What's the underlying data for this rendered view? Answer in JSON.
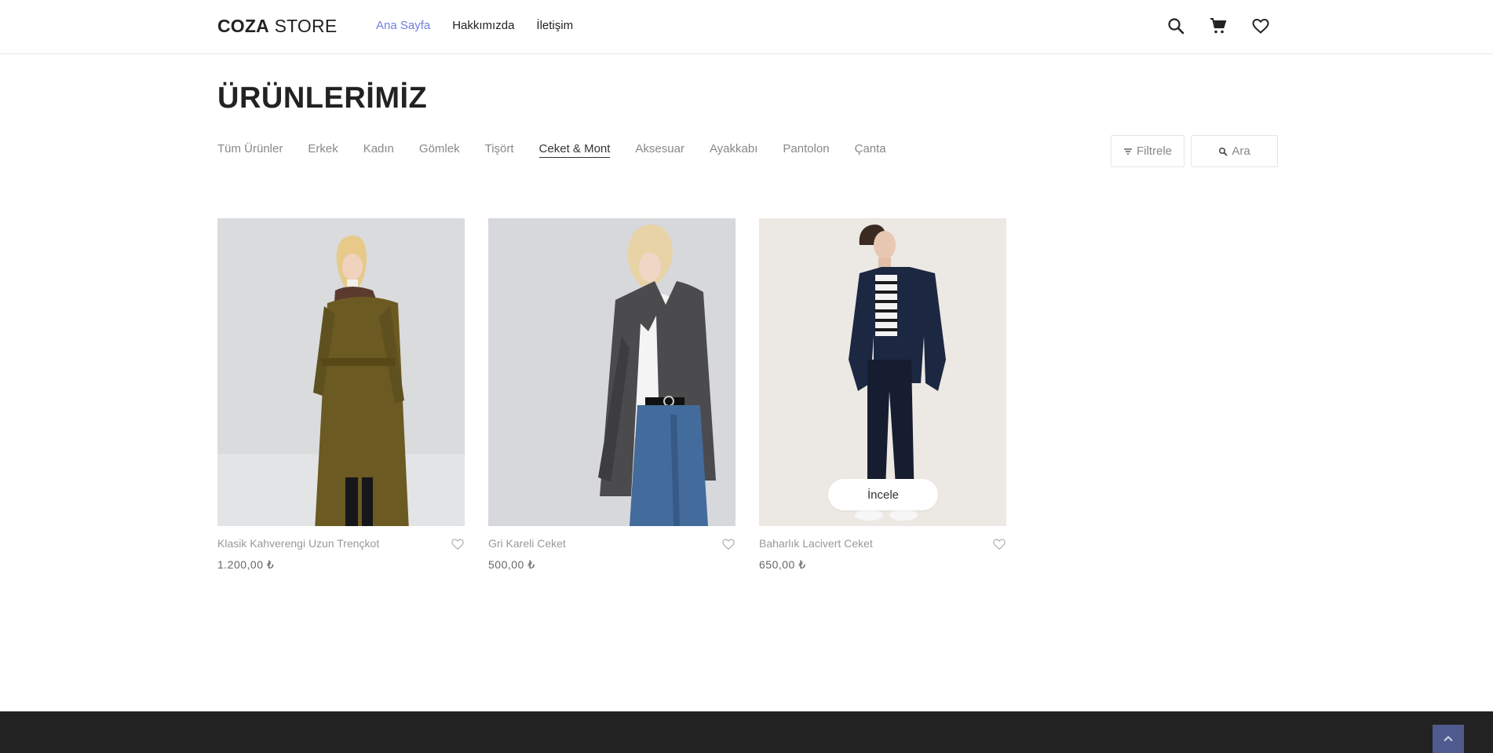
{
  "header": {
    "logo_bold": "COZA",
    "logo_light": "STORE",
    "nav": [
      {
        "label": "Ana Sayfa",
        "active": true
      },
      {
        "label": "Hakkımızda",
        "active": false
      },
      {
        "label": "İletişim",
        "active": false
      }
    ],
    "icons": [
      "search-icon",
      "cart-icon",
      "heart-icon"
    ]
  },
  "page": {
    "title": "ÜRÜNLERİMİZ"
  },
  "categories": [
    {
      "label": "Tüm Ürünler",
      "active": false
    },
    {
      "label": "Erkek",
      "active": false
    },
    {
      "label": "Kadın",
      "active": false
    },
    {
      "label": "Gömlek",
      "active": false
    },
    {
      "label": "Tişört",
      "active": false
    },
    {
      "label": "Ceket & Mont",
      "active": true
    },
    {
      "label": "Aksesuar",
      "active": false
    },
    {
      "label": "Ayakkabı",
      "active": false
    },
    {
      "label": "Pantolon",
      "active": false
    },
    {
      "label": "Çanta",
      "active": false
    }
  ],
  "tools": {
    "filter_label": "Filtrele",
    "search_label": "Ara"
  },
  "products": [
    {
      "name": "Klasik Kahverengi Uzun Trençkot",
      "price": "1.200,00 ₺"
    },
    {
      "name": "Gri Kareli Ceket",
      "price": "500,00 ₺"
    },
    {
      "name": "Baharlık Lacivert Ceket",
      "price": "650,00 ₺",
      "quick_view": "İncele"
    }
  ],
  "colors": {
    "accent": "#717fe0",
    "footer": "#222222",
    "back_to_top": "#4f5a8e"
  }
}
